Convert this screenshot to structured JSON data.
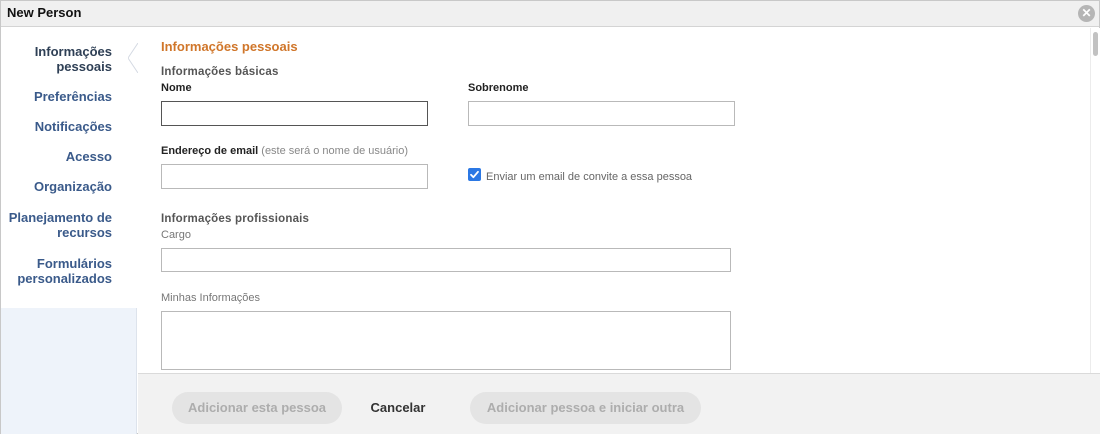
{
  "window": {
    "title": "New Person",
    "close_symbol": "✕"
  },
  "sidebar": {
    "items": [
      {
        "line1": "Informações",
        "line2": "pessoais",
        "active": true
      },
      {
        "line1": "Preferências",
        "line2": ""
      },
      {
        "line1": "Notificações",
        "line2": ""
      },
      {
        "line1": "Acesso",
        "line2": ""
      },
      {
        "line1": "Organização",
        "line2": ""
      },
      {
        "line1": "Planejamento de",
        "line2": "recursos"
      },
      {
        "line1": "Formulários",
        "line2": "personalizados"
      }
    ]
  },
  "form": {
    "section_title": "Informações pessoais",
    "basic": {
      "group_title": "Informações básicas",
      "first_name_label": "Nome",
      "first_name_value": "",
      "last_name_label": "Sobrenome",
      "last_name_value": "",
      "email_label": "Endereço de email",
      "email_hint": "(este será o nome de usuário)",
      "email_value": "",
      "invite_label": "Enviar um email de convite a essa pessoa",
      "invite_checked": true
    },
    "professional": {
      "group_title": "Informações profissionais",
      "job_title_label": "Cargo",
      "job_title_value": "",
      "about_label": "Minhas Informações",
      "about_value": ""
    }
  },
  "footer": {
    "add_label": "Adicionar esta pessoa",
    "cancel_label": "Cancelar",
    "add_another_label": "Adicionar pessoa e iniciar outra"
  },
  "colors": {
    "accent_orange": "#d0762a",
    "nav_blue": "#3a5a8a",
    "checkbox_blue": "#2b78e4",
    "sidebar_bg": "#eef3fa",
    "footer_bg": "#f2f2f2"
  },
  "icons": {
    "close": "close-icon",
    "check": "checkmark-icon"
  }
}
